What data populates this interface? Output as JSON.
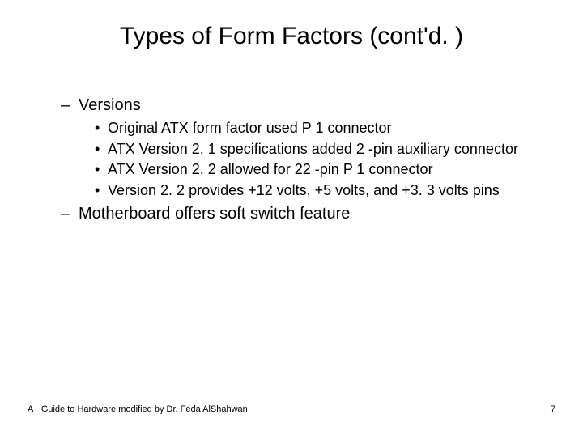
{
  "title": "Types of Form Factors (cont'd. )",
  "items": [
    {
      "text": "Versions",
      "sub": [
        "Original ATX form factor used P 1 connector",
        "ATX Version 2. 1 specifications added 2 -pin auxiliary connector",
        "ATX Version 2. 2 allowed for 22 -pin P 1 connector",
        "Version 2. 2 provides +12 volts, +5 volts, and +3. 3 volts pins"
      ]
    },
    {
      "text": "Motherboard offers soft switch feature",
      "sub": []
    }
  ],
  "footer_left": "A+ Guide to Hardware modified by Dr. Feda AlShahwan",
  "footer_right": "7"
}
